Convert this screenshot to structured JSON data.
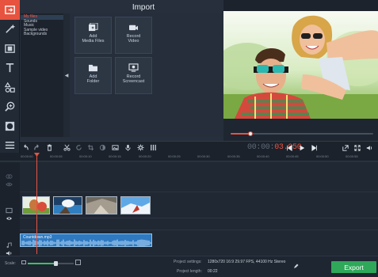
{
  "sidebar": {
    "tools": [
      {
        "icon": "import-icon",
        "active": true
      },
      {
        "icon": "magic-wand-icon"
      },
      {
        "icon": "filmstrip-icon"
      },
      {
        "icon": "text-icon"
      },
      {
        "icon": "shapes-icon"
      },
      {
        "icon": "zoom-icon"
      },
      {
        "icon": "circle-filter-icon"
      },
      {
        "icon": "menu-icon"
      }
    ]
  },
  "import": {
    "title": "Import",
    "categories": [
      "My files",
      "Sounds",
      "Music",
      "Sample video",
      "Backgrounds"
    ],
    "selected_category": "My files",
    "tiles": [
      {
        "label": "Add\nMedia Files",
        "icon": "add-media-icon"
      },
      {
        "label": "Record\nVideo",
        "icon": "camera-icon"
      },
      {
        "label": "Add\nFolder",
        "icon": "folder-icon"
      },
      {
        "label": "Record\nScreencast",
        "icon": "screencast-icon"
      }
    ]
  },
  "player": {
    "progress": 0.14,
    "timecode_dim": "00:00:",
    "timecode_active": "03.050"
  },
  "ruler": {
    "ticks": [
      "00:00:00",
      "00:00:05",
      "00:00:10",
      "00:00:15",
      "00:00:20",
      "00:00:25",
      "00:00:30",
      "00:00:35",
      "00:00:40",
      "00:00:45",
      "00:00:50",
      "00:00:55"
    ]
  },
  "audio": {
    "clip_label": "Countdown.mp3"
  },
  "status": {
    "scale_label": "Scale:",
    "scale_value": 0.6,
    "settings_label": "Project settings:",
    "settings_value": "1280x720 16:9 29.97 FPS, 44100 Hz Stereo",
    "length_label": "Project length:",
    "length_value": "00:22",
    "export_label": "Export"
  },
  "colors": {
    "accent": "#e8533f",
    "export": "#2fa85a",
    "audio": "#2e79c0"
  }
}
